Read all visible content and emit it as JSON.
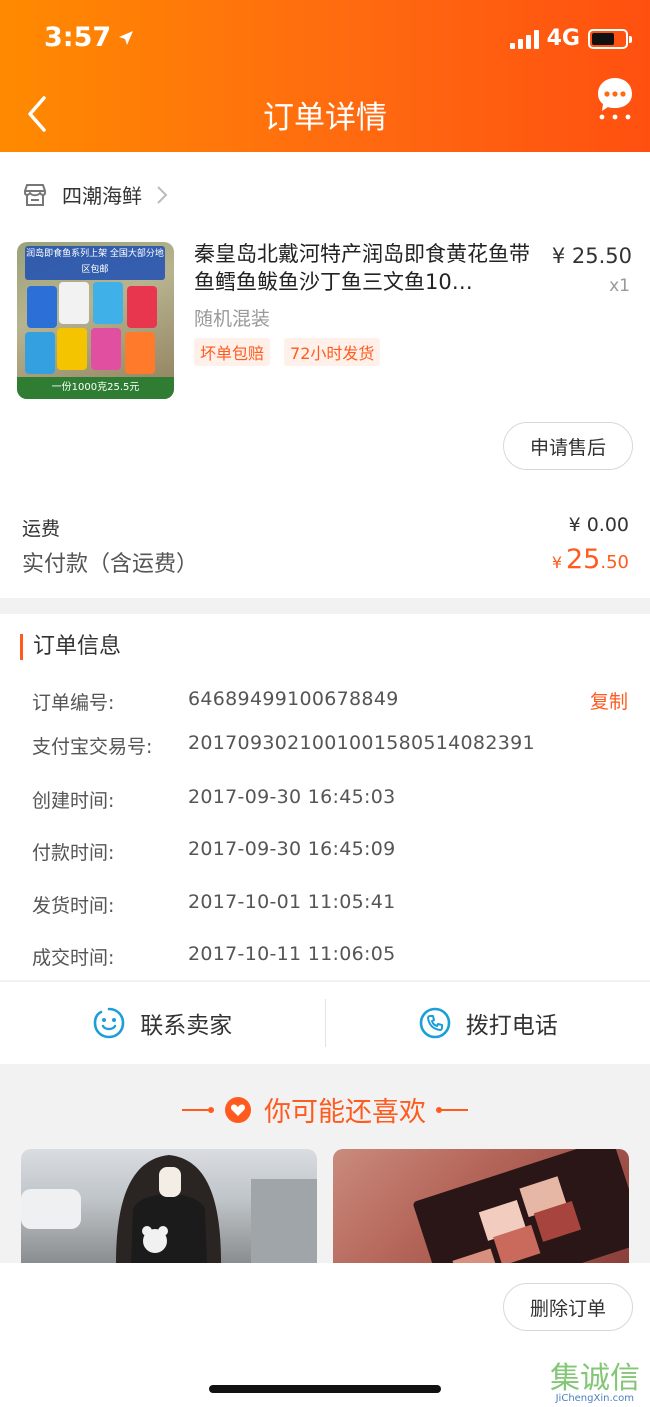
{
  "status_bar": {
    "time": "3:57",
    "network": "4G"
  },
  "header": {
    "title": "订单详情"
  },
  "shop": {
    "name": "四潮海鲜"
  },
  "product": {
    "title": "秦皇岛北戴河特产润岛即食黄花鱼带鱼鳕鱼鲅鱼沙丁鱼三文鱼10…",
    "price": "¥ 25.50",
    "qty": "x1",
    "variant": "随机混装",
    "tags": [
      "坏单包赔",
      "72小时发货"
    ],
    "thumb_top_text": "润岛即食鱼系列上架 全国大部分地区包邮",
    "thumb_bottom_text": "一份1000克25.5元"
  },
  "aftersale_label": "申请售后",
  "fees": {
    "shipping_label": "运费",
    "shipping_value": "¥ 0.00",
    "paid_label": "实付款（含运费）",
    "paid_symbol": "¥",
    "paid_int": "25",
    "paid_dec": ".50"
  },
  "order_info": {
    "title": "订单信息",
    "copy_label": "复制",
    "rows": [
      {
        "key": "订单编号:",
        "value": "64689499100678849"
      },
      {
        "key": "支付宝交易号:",
        "value": "2017093021001001580514082391"
      },
      {
        "key": "创建时间:",
        "value": "2017-09-30 16:45:03"
      },
      {
        "key": "付款时间:",
        "value": "2017-09-30 16:45:09"
      },
      {
        "key": "发货时间:",
        "value": "2017-10-01 11:05:41"
      },
      {
        "key": "成交时间:",
        "value": "2017-10-11 11:06:05"
      }
    ]
  },
  "contact": {
    "seller_label": "联系卖家",
    "phone_label": "拨打电话"
  },
  "recommend": {
    "title": "你可能还喜欢"
  },
  "bottom": {
    "delete_label": "删除订单"
  },
  "watermark": {
    "text": "集诚信",
    "sub": "JiChengXin.com"
  },
  "colors": {
    "accent": "#ff5b1f",
    "header_start": "#ff8a00",
    "header_end": "#ff5010",
    "icon_blue": "#1a9fd9"
  }
}
